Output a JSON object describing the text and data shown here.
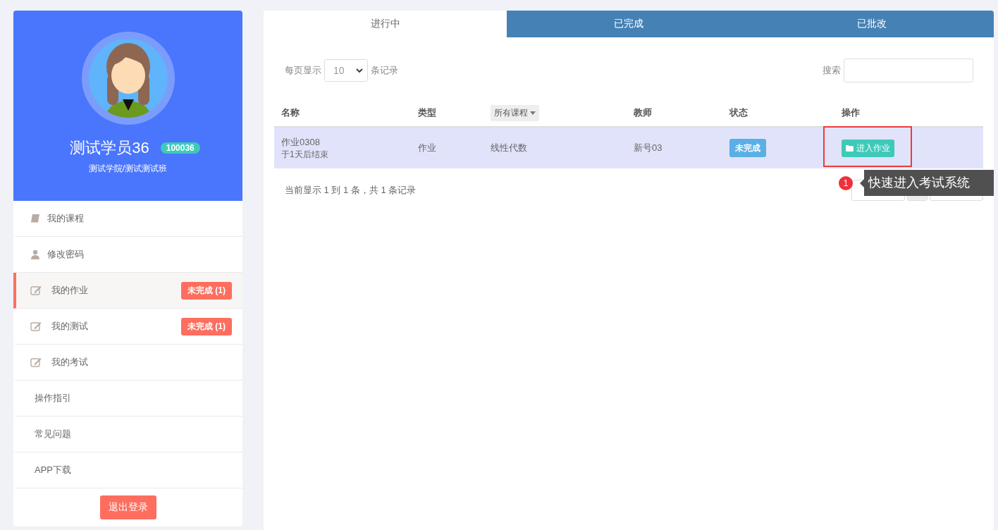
{
  "profile": {
    "name": "测试学员36",
    "id_badge": "100036",
    "org": "测试学院/测试测试班"
  },
  "menu": [
    {
      "label": "我的课程",
      "kind": "book",
      "selected": false
    },
    {
      "label": "修改密码",
      "kind": "user",
      "selected": false
    },
    {
      "label": "我的作业",
      "kind": "edit",
      "selected": true,
      "badge": "未完成 (1)"
    },
    {
      "label": "我的测试",
      "kind": "edit",
      "selected": false,
      "badge": "未完成 (1)"
    },
    {
      "label": "我的考试",
      "kind": "edit",
      "selected": false
    },
    {
      "label": "操作指引",
      "kind": "plain",
      "selected": false
    },
    {
      "label": "常见问题",
      "kind": "plain",
      "selected": false
    },
    {
      "label": "APP下载",
      "kind": "plain",
      "selected": false
    }
  ],
  "logout_button": "退出登录",
  "tabs": [
    {
      "label": "进行中",
      "selected": true
    },
    {
      "label": "已完成",
      "selected": false
    },
    {
      "label": "已批改",
      "selected": false
    }
  ],
  "length_menu": {
    "prefix": "每页显示",
    "value": "10",
    "suffix": "条记录"
  },
  "search": {
    "label": "搜索"
  },
  "table": {
    "columns": [
      {
        "label": "名称",
        "kind": "text"
      },
      {
        "label": "类型",
        "kind": "text"
      },
      {
        "label": "所有课程",
        "kind": "filter"
      },
      {
        "label": "教师",
        "kind": "text"
      },
      {
        "label": "状态",
        "kind": "text"
      },
      {
        "label": "操作",
        "kind": "text"
      }
    ],
    "rows": [
      {
        "name": "作业0308",
        "deadline": "于1天后结束",
        "type": "作业",
        "course": "线性代数",
        "teacher": "新号03",
        "status": "未完成",
        "action": "进入作业",
        "selected": true
      }
    ]
  },
  "info": "当前显示 1 到 1 条，共 1 条记录",
  "pagination": [
    {
      "kind": "prev",
      "selected": false
    },
    {
      "kind": "page",
      "selected": true
    },
    {
      "kind": "next",
      "selected": false
    }
  ],
  "guide": {
    "step": "1",
    "text": "快速进入考试系统"
  }
}
